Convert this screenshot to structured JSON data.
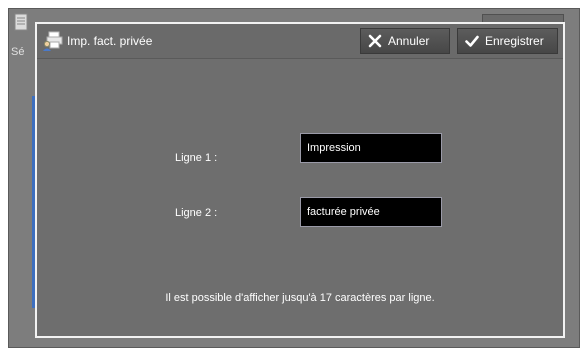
{
  "background": {
    "title": "",
    "sub_label": "Sé"
  },
  "dialog": {
    "title": "Imp. fact. privée",
    "cancel_label": "Annuler",
    "save_label": "Enregistrer"
  },
  "form": {
    "line1_label": "Ligne 1 :",
    "line1_value": "Impression",
    "line2_label": "Ligne 2 :",
    "line2_value": "facturée privée",
    "hint": "Il est possible d'afficher jusqu'à 17 caractères par ligne."
  },
  "icons": {
    "dialog": "printer-user-icon",
    "cancel": "close-x-icon",
    "save": "checkmark-icon"
  },
  "colors": {
    "dialog_bg": "#6e6e6e",
    "field_bg": "#000000",
    "accent_blue": "#3d6fbf"
  }
}
